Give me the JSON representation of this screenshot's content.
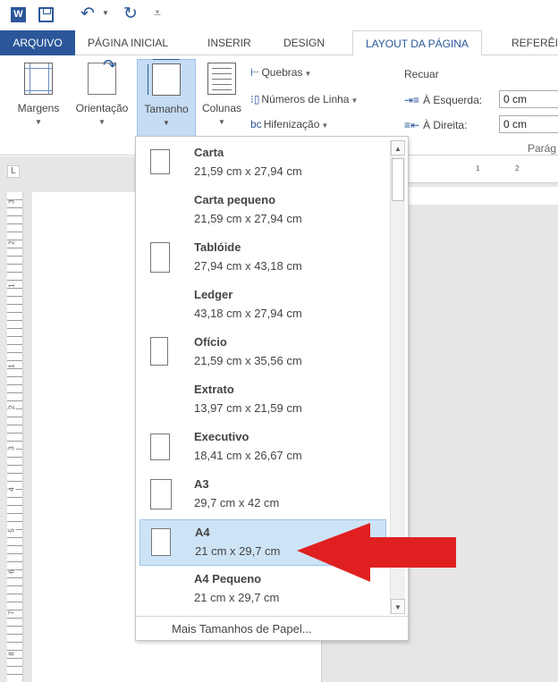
{
  "quick_access": {
    "app_icon": "word-icon",
    "app_letter": "W",
    "save_icon": "save-icon",
    "undo_icon": "undo-icon",
    "redo_icon": "redo-icon",
    "customize_icon": "customize-qat-icon"
  },
  "tabs": [
    {
      "label": "ARQUIVO"
    },
    {
      "label": "PÁGINA INICIAL"
    },
    {
      "label": "INSERIR"
    },
    {
      "label": "DESIGN"
    },
    {
      "label": "LAYOUT DA PÁGINA"
    },
    {
      "label": "REFERÊI"
    }
  ],
  "ribbon": {
    "margins": "Margens",
    "orientation": "Orientação",
    "size": "Tamanho",
    "columns": "Colunas",
    "breaks": "Quebras",
    "line_numbers": "Números de Linha",
    "hyphenation": "Hifenização",
    "indent_title": "Recuar",
    "indent_left_label": "À Esquerda:",
    "indent_left_value": "0 cm",
    "indent_right_label": "À Direita:",
    "indent_right_value": "0 cm",
    "paragraph_group": "Parág"
  },
  "ruler": {
    "corner": "L",
    "vertical_numbers": [
      "3",
      "2",
      "1",
      "1",
      "2",
      "3",
      "4",
      "5",
      "6",
      "7",
      "8"
    ],
    "horizontal_numbers": [
      "1",
      "2"
    ]
  },
  "paper_sizes": {
    "selected": "A4",
    "items": [
      {
        "name": "Carta",
        "dims": "21,59 cm x 27,94 cm"
      },
      {
        "name": "Carta pequeno",
        "dims": "21,59 cm x 27,94 cm"
      },
      {
        "name": "Tablóide",
        "dims": "27,94 cm x 43,18 cm"
      },
      {
        "name": "Ledger",
        "dims": "43,18 cm x 27,94 cm"
      },
      {
        "name": "Ofício",
        "dims": "21,59 cm x 35,56 cm"
      },
      {
        "name": "Extrato",
        "dims": "13,97 cm x 21,59 cm"
      },
      {
        "name": "Executivo",
        "dims": "18,41 cm x 26,67 cm"
      },
      {
        "name": "A3",
        "dims": "29,7 cm x 42 cm"
      },
      {
        "name": "A4",
        "dims": "21 cm x 29,7 cm"
      },
      {
        "name": "A4 Pequeno",
        "dims": "21 cm x 29,7 cm"
      }
    ],
    "more": "Mais Tamanhos de Papel..."
  },
  "colors": {
    "accent": "#2b579a",
    "selection": "#cde4f7",
    "arrow": "#e02020"
  }
}
